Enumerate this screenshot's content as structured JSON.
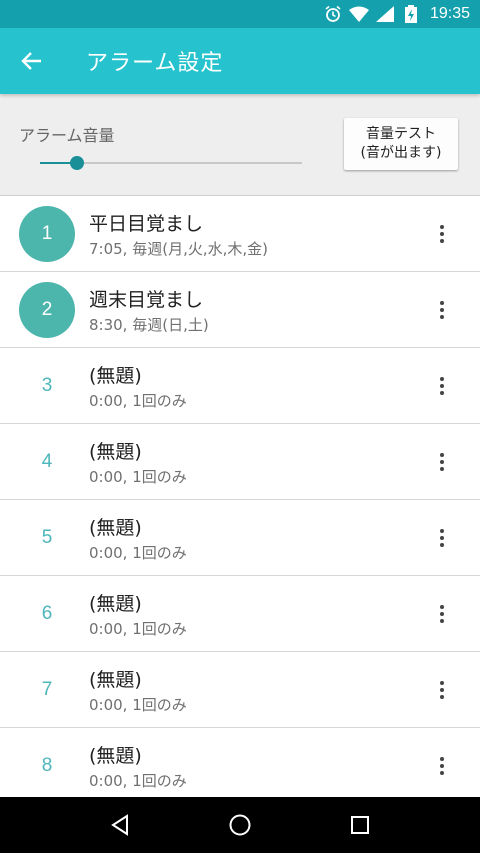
{
  "status_bar": {
    "time": "19:35",
    "icons": [
      "alarm-icon",
      "wifi-icon",
      "signal-icon",
      "battery-charging-icon"
    ]
  },
  "app_bar": {
    "title": "アラーム設定",
    "back_icon": "arrow-back-icon"
  },
  "volume": {
    "label": "アラーム音量",
    "level": 0.14,
    "test_button": "音量テスト\n(音が出ます)"
  },
  "alarms": [
    {
      "number": "1",
      "title": "平日目覚まし",
      "subtitle": "7:05, 毎週(月,火,水,木,金)",
      "enabled": true
    },
    {
      "number": "2",
      "title": "週末目覚まし",
      "subtitle": "8:30, 毎週(日,土)",
      "enabled": true
    },
    {
      "number": "3",
      "title": "(無題)",
      "subtitle": "0:00, 1回のみ",
      "enabled": false
    },
    {
      "number": "4",
      "title": "(無題)",
      "subtitle": "0:00, 1回のみ",
      "enabled": false
    },
    {
      "number": "5",
      "title": "(無題)",
      "subtitle": "0:00, 1回のみ",
      "enabled": false
    },
    {
      "number": "6",
      "title": "(無題)",
      "subtitle": "0:00, 1回のみ",
      "enabled": false
    },
    {
      "number": "7",
      "title": "(無題)",
      "subtitle": "0:00, 1回のみ",
      "enabled": false
    },
    {
      "number": "8",
      "title": "(無題)",
      "subtitle": "0:00, 1回のみ",
      "enabled": false
    }
  ],
  "nav_bar": {
    "buttons": [
      "back-triangle-icon",
      "home-circle-icon",
      "recents-square-icon"
    ]
  },
  "colors": {
    "status_bar": "#14a1ad",
    "app_bar": "#26c3cf",
    "accent": "#4db6ac",
    "slider": "#1a8f97"
  }
}
